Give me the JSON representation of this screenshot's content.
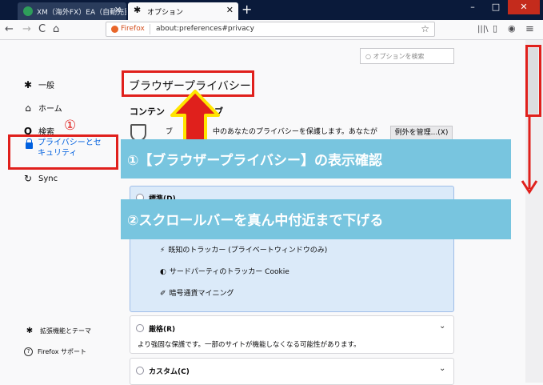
{
  "window": {
    "tabs": [
      {
        "title": "XM（海外FX）EA（自動売買",
        "close": "✕",
        "active": false
      },
      {
        "title": "オプション",
        "close": "✕",
        "active": true
      }
    ],
    "new_tab": "+",
    "controls": {
      "minimize": "–",
      "maximize": "□",
      "close": "✕"
    }
  },
  "navbar": {
    "back": "←",
    "forward": "→",
    "reload": "C",
    "home": "⌂",
    "brand": "Firefox",
    "url": "about:preferences#privacy",
    "star": "☆",
    "library": "|||\\",
    "sidebar": "▯",
    "account": "◉",
    "menu": "≡"
  },
  "prefs_search": {
    "placeholder": "オプションを検索",
    "icon": "○"
  },
  "sidebar": {
    "items": [
      {
        "label": "一般",
        "icon": "✱"
      },
      {
        "label": "ホーム",
        "icon": "⌂"
      },
      {
        "label": "検索",
        "icon": "Q"
      },
      {
        "label": "プライバシーとセキュリティ",
        "line1": "プライバシーとセ",
        "line2": "キュリティ"
      },
      {
        "label": "Sync",
        "icon": "↻"
      }
    ],
    "footer": [
      {
        "label": "拡張機能とテーマ",
        "icon": "✱"
      },
      {
        "label": "Firefox サポート",
        "icon": "?"
      }
    ]
  },
  "main": {
    "heading": "ブラウザープライバシー",
    "subheading_left": "コンテン",
    "subheading_right": "ブ",
    "description_left": "ブ",
    "description_right": "中のあなたのプライバシーを保護します。あなたが",
    "exceptions_button": "例外を管理...(X)",
    "standard_label": "標準(D)",
    "blocked_items": [
      {
        "icon": "⚡",
        "label": "既知のトラッカー (プライベートウィンドウのみ)"
      },
      {
        "icon": "◐",
        "label": "サードパーティのトラッカー Cookie"
      },
      {
        "icon": "✐",
        "label": "暗号通貨マイニング"
      }
    ],
    "strict": {
      "label": "厳格(R)",
      "description": "より強固な保護です。一部のサイトが機能しなくなる可能性があります。",
      "chevron": "⌄"
    },
    "custom": {
      "label": "カスタム(C)",
      "chevron": "⌄"
    }
  },
  "annotations": {
    "circle_one": "①",
    "banner1": "①【ブラウザープライバシー】の表示確認",
    "banner2": "②スクロールバーを真ん中付近まで下げる",
    "colors": {
      "red": "#e0201c",
      "yellow": "#ffe400",
      "cyan": "#78c5df",
      "accent": "#0060df"
    }
  }
}
